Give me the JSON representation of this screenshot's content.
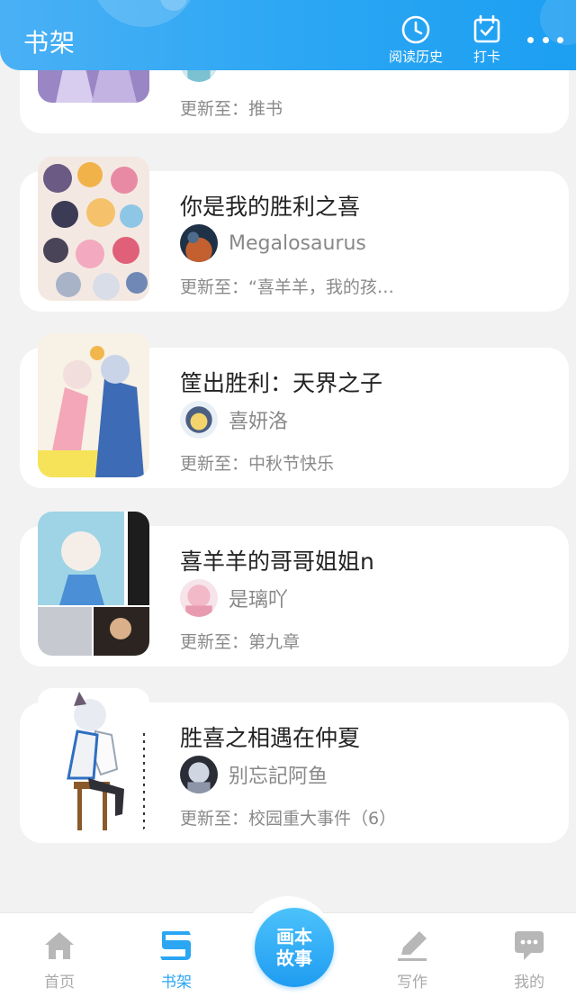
{
  "header": {
    "title": "书架",
    "history_label": "阅读历史",
    "checkin_label": "打卡",
    "history_icon": "clock-icon",
    "checkin_icon": "calendar-check-icon",
    "more_icon": "more-dots-icon",
    "color": "#2aa6f3"
  },
  "books": [
    {
      "title": "",
      "author": "",
      "update_label": "更新至：",
      "update_value": "推书"
    },
    {
      "title": "你是我的胜利之喜",
      "author": "Megalosaurus",
      "update_label": "更新至：",
      "update_value": "“喜羊羊，我的孩…"
    },
    {
      "title": "筐出胜利：天界之子",
      "author": "喜妍洛",
      "update_label": "更新至：",
      "update_value": "中秋节快乐"
    },
    {
      "title": "喜羊羊的哥哥姐姐n",
      "author": "是璃吖",
      "update_label": "更新至：",
      "update_value": "第九章"
    },
    {
      "title": "胜喜之相遇在仲夏",
      "author": "别忘記阿鱼",
      "update_label": "更新至：",
      "update_value": "校园重大事件（6）"
    }
  ],
  "bottom_nav": {
    "home_label": "首页",
    "shelf_label": "书架",
    "center_line1": "画本",
    "center_line2": "故事",
    "write_label": "写作",
    "mine_label": "我的",
    "active_color": "#2aa6f3",
    "inactive_color": "#a9a9a9"
  }
}
